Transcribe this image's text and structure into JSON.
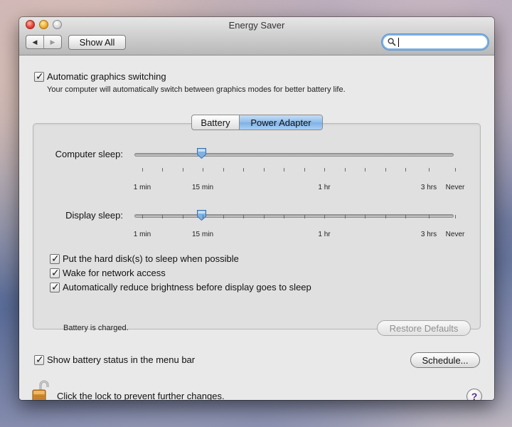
{
  "window": {
    "title": "Energy Saver",
    "nav_back": "◀",
    "nav_forward": "▶",
    "show_all": "Show All",
    "search": {
      "value": "",
      "placeholder": ""
    },
    "search_icon": "magnifier-icon"
  },
  "graphics_switching": {
    "label": "Automatic graphics switching",
    "checked": true,
    "description": "Your computer will automatically switch between graphics modes for better battery life."
  },
  "tabs": [
    {
      "label": "Battery",
      "selected": false
    },
    {
      "label": "Power Adapter",
      "selected": true
    }
  ],
  "computer_sleep": {
    "label": "Computer sleep:",
    "value": "10 min",
    "ticks": [
      "1 min",
      "15 min",
      "1 hr",
      "3 hrs",
      "Never"
    ]
  },
  "display_sleep": {
    "label": "Display sleep:",
    "value": "10 min",
    "ticks": [
      "1 min",
      "15 min",
      "1 hr",
      "3 hrs",
      "Never"
    ]
  },
  "options": [
    {
      "label": "Put the hard disk(s) to sleep when possible",
      "checked": true
    },
    {
      "label": "Wake for network access",
      "checked": true
    },
    {
      "label": "Automatically reduce brightness before display goes to sleep",
      "checked": true
    }
  ],
  "battery_status": "Battery is charged.",
  "restore_defaults": "Restore Defaults",
  "show_battery_status": {
    "label": "Show battery status in the menu bar",
    "checked": true
  },
  "schedule": "Schedule...",
  "lock_text": "Click the lock to prevent further changes.",
  "help": "?",
  "colors": {
    "accent": "#8fbde9",
    "help_mark": "#5a2a8a",
    "lock_body": "#d08a30"
  }
}
